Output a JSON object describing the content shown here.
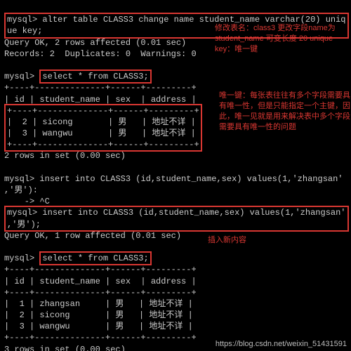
{
  "line1_prompt": "mysql> ",
  "line1_cmd": "alter table CLASS3 change name student_name varchar(20) uniq",
  "line1b": "ue key;",
  "q1": "Query OK, 2 rows affected (0.01 sec)",
  "q2": "Records: 2  Duplicates: 0  Warnings: 0",
  "sel1": "select * from CLASS3;",
  "tbl_border": "+----+--------------+------+---------+",
  "tbl_head": "| id | student_name | sex  | address |",
  "tbl_r1": "|  2 | sicong       | 男   | 地址不详 |",
  "tbl_r2": "|  3 | wangwu       | 男   | 地址不详 |",
  "rows1": "2 rows in set (0.00 sec)",
  "ins1a": "insert into CLASS3 (id,student_name,sex) values(1,'zhangsan'",
  "ins1b": ",'男'):",
  "ctrlc": "    -> ^C",
  "ins2a": "insert into CLASS3 (id,student_name,sex) values(1,'zhangsan'",
  "ins2b": ",'男');",
  "q3": "Query OK, 1 row affected (0.01 sec)",
  "sel2": "select * from CLASS3;",
  "t2_r1": "|  1 | zhangsan     | 男   | 地址不详 |",
  "t2_r2": "|  2 | sicong       | 男   | 地址不详 |",
  "t2_r3": "|  3 | wangwu       | 男   | 地址不详 |",
  "rows2": "3 rows in set (0.00 sec)",
  "ann1": "修改表名：class3 更改字段name为student_name 可变长度 20 unique key：唯一键",
  "ann2": "唯一键：每张表往往有多个字段需要具有唯一性，但是只能指定一个主键，因此，唯一见就是用来解决表中多个字段需要具有唯一性的问题",
  "ann3": "插入新内容",
  "wm": "https://blog.csdn.net/weixin_51431591"
}
